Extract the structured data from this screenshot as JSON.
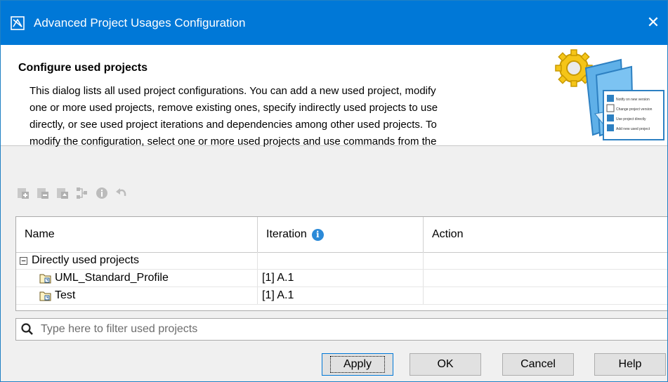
{
  "window": {
    "title": "Advanced Project Usages Configuration",
    "close_glyph": "✕"
  },
  "header": {
    "title": "Configure used projects",
    "description_lines": [
      "This dialog lists all used project configurations. You can add a new used project, modify",
      "one or more used projects, remove existing ones, specify indirectly used projects to use",
      "directly, or see used project iterations and dependencies among other used projects. To",
      "modify the configuration, select one or more used projects and use commands from the"
    ],
    "illustration_items": [
      "Notify on new version",
      "Change project version",
      "Use project directly",
      "Add new used project"
    ]
  },
  "toolbar": {
    "icons": [
      "add-used-project-icon",
      "remove-used-project-icon",
      "use-directly-icon",
      "dependencies-icon",
      "info-icon",
      "undo-icon"
    ]
  },
  "table": {
    "columns": [
      "Name",
      "Iteration",
      "Action"
    ],
    "group": {
      "expander": "−",
      "label": "Directly used projects"
    },
    "rows": [
      {
        "name": "UML_Standard_Profile",
        "iteration": "[1] A.1",
        "action": ""
      },
      {
        "name": "Test",
        "iteration": "[1] A.1",
        "action": ""
      }
    ]
  },
  "filter": {
    "placeholder": "Type here to filter used projects",
    "value": ""
  },
  "buttons": {
    "apply": "Apply",
    "ok": "OK",
    "cancel": "Cancel",
    "help": "Help"
  },
  "colors": {
    "titlebar": "#0078d7",
    "info_badge": "#2b8ad8"
  }
}
